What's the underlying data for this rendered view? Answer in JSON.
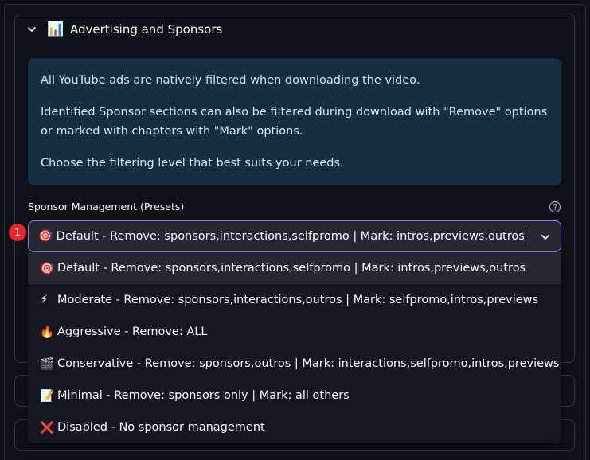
{
  "expander": {
    "icon": "📊",
    "title": "Advertising and Sponsors"
  },
  "info": {
    "p1": "All YouTube ads are natively filtered when downloading the video.",
    "p2": "Identified Sponsor sections can also be filtered during download with \"Remove\" options or marked with chapters with \"Mark\" options.",
    "p3": "Choose the filtering level that best suits your needs."
  },
  "select": {
    "label": "Sponsor Management (Presets)",
    "value": "🎯 Default - Remove: sponsors,interactions,selfpromo | Mark: intros,previews,outros",
    "options": [
      {
        "emoji": "🎯",
        "text": "Default - Remove: sponsors,interactions,selfpromo | Mark: intros,previews,outros"
      },
      {
        "emoji": "⚡",
        "text": "Moderate - Remove: sponsors,interactions,outros | Mark: selfpromo,intros,previews"
      },
      {
        "emoji": "🔥",
        "text": "Aggressive - Remove: ALL"
      },
      {
        "emoji": "🎬",
        "text": "Conservative - Remove: sponsors,outros | Mark: interactions,selfpromo,intros,previews"
      },
      {
        "emoji": "📝",
        "text": "Minimal - Remove: sponsors only | Mark: all others"
      },
      {
        "emoji": "❌",
        "text": "Disabled - No sponsor management"
      }
    ]
  },
  "badge": "1",
  "colors": {
    "background": "#0e1117",
    "info_bg": "#172d43",
    "info_text": "#c7ebff",
    "focus_border": "#7c83fd",
    "badge": "#e8262a"
  }
}
